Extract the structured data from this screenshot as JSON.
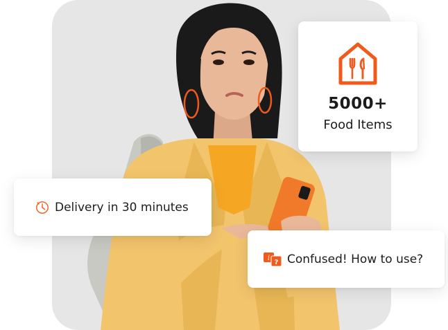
{
  "colors": {
    "accent": "#f05a1a",
    "panel_bg": "#e6e6e6",
    "jacket": "#f2c46c",
    "shirt": "#f5a623",
    "phone": "#f07a2a",
    "hair": "#1a1a1a",
    "skin": "#e9b899"
  },
  "photo": {
    "subject": "woman-looking-confused-holding-phone"
  },
  "stat_card": {
    "icon": "restaurant-house-icon",
    "number": "5000+",
    "label": "Food Items"
  },
  "delivery_card": {
    "icon": "clock-icon",
    "text": "Delivery in 30 minutes"
  },
  "confused_card": {
    "icon": "info-question-icon",
    "text": "Confused! How to use?"
  }
}
